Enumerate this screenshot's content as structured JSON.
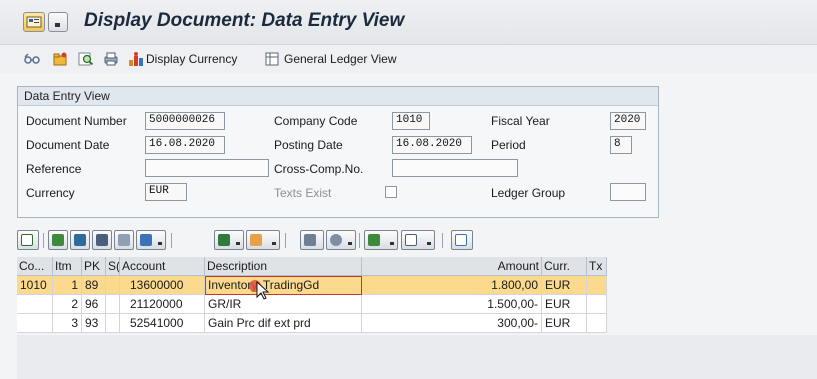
{
  "window": {
    "title": "Display Document: Data Entry View"
  },
  "toolbar": {
    "display_currency": "Display Currency",
    "general_ledger_view": "General Ledger View"
  },
  "data_entry": {
    "frame_title": "Data Entry View",
    "document_number_label": "Document Number",
    "document_number": "5000000026",
    "company_code_label": "Company Code",
    "company_code": "1010",
    "fiscal_year_label": "Fiscal Year",
    "fiscal_year": "2020",
    "document_date_label": "Document Date",
    "document_date": "16.08.2020",
    "posting_date_label": "Posting Date",
    "posting_date": "16.08.2020",
    "period_label": "Period",
    "period": "8",
    "reference_label": "Reference",
    "reference": "",
    "cross_comp_label": "Cross-Comp.No.",
    "cross_comp": "",
    "currency_label": "Currency",
    "currency": "EUR",
    "texts_exist_label": "Texts Exist",
    "ledger_group_label": "Ledger Group",
    "ledger_group": ""
  },
  "grid": {
    "headers": {
      "co": "Co...",
      "itm": "Itm",
      "pk": "PK",
      "s": "S(",
      "account": "Account",
      "description": "Description",
      "amount": "Amount",
      "curr": "Curr.",
      "tx": "Tx"
    },
    "rows": [
      {
        "co": "1010",
        "itm": "1",
        "pk": "89",
        "account": "13600000",
        "description": "Inventory, TradingGd",
        "amount": "1.800,00",
        "curr": "EUR",
        "tx": ""
      },
      {
        "co": "",
        "itm": "2",
        "pk": "96",
        "account": "21120000",
        "description": "GR/IR",
        "amount": "1.500,00-",
        "curr": "EUR",
        "tx": ""
      },
      {
        "co": "",
        "itm": "3",
        "pk": "93",
        "account": "52541000",
        "description": "Gain Prc dif ext prd",
        "amount": "300,00-",
        "curr": "EUR",
        "tx": ""
      }
    ]
  },
  "icons": {
    "menu": "sap-menu-icon",
    "dropdown": "chevron-down-icon",
    "toolbar": [
      "glasses-icon",
      "folder-icon",
      "search-icon",
      "print-icon",
      "display-currency-icon",
      "ledger-view-icon"
    ],
    "grid_toolbar": [
      "details-icon",
      "sort-ascending-icon",
      "sort-descending-icon",
      "find-icon",
      "find-next-icon",
      "filter-icon",
      "sum-icon",
      "subtotal-icon",
      "print-preview-icon",
      "views-icon",
      "export-icon",
      "layout-icon",
      "info-icon"
    ],
    "cursor": "mouse-pointer-icon"
  },
  "colors": {
    "selected_row": "#fbd98d",
    "header_bg": "#dfe3e8"
  }
}
